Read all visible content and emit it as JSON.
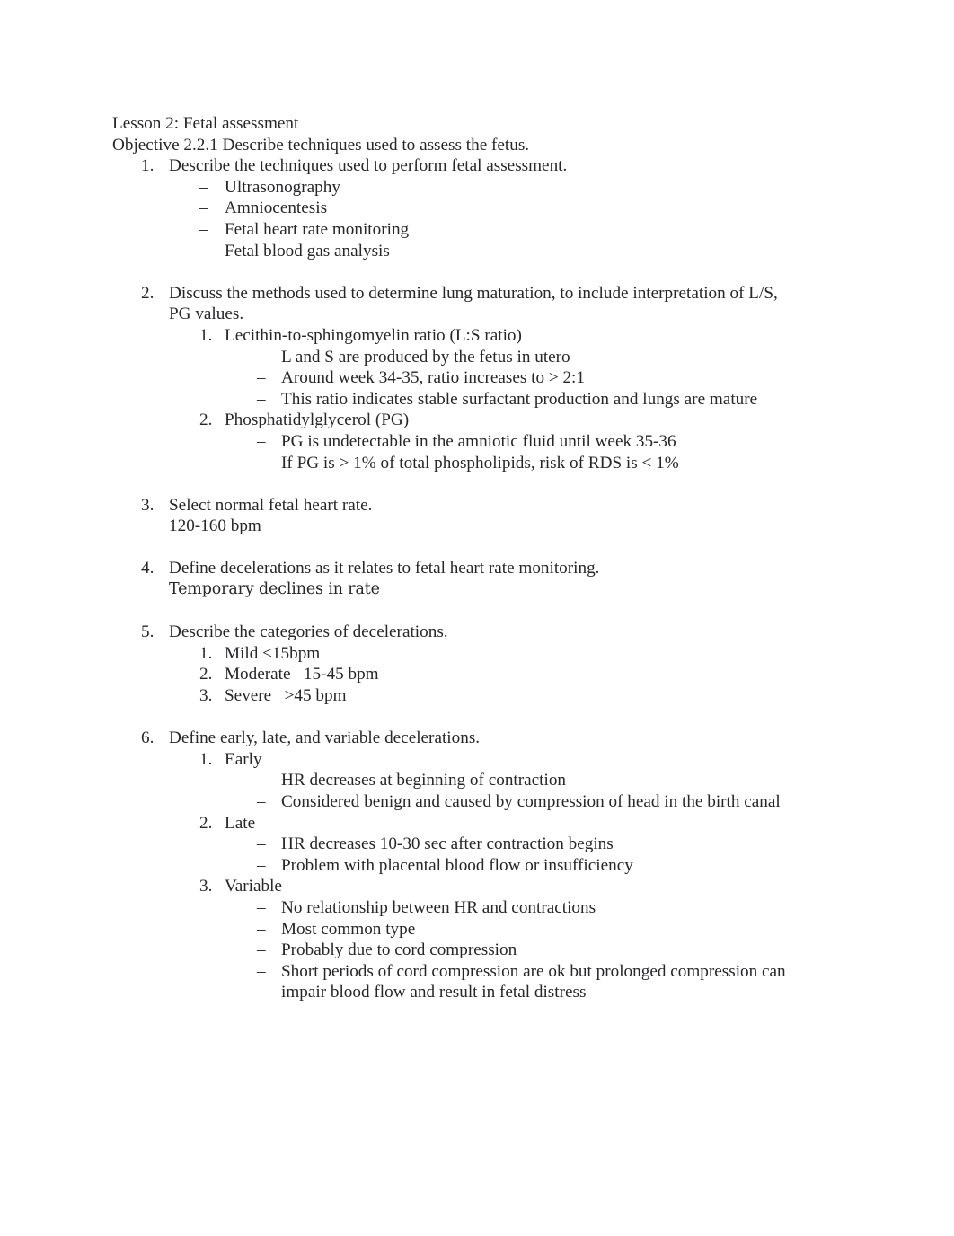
{
  "document": {
    "title_line": "Lesson 2: Fetal assessment",
    "objective_line": "Objective 2.2.1 Describe techniques used to assess the fetus.",
    "items": [
      {
        "marker": "1.",
        "text": "Describe the techniques used to perform fetal assessment.",
        "sub": [
          {
            "marker": "–",
            "text": "Ultrasonography"
          },
          {
            "marker": "–",
            "text": "Amniocentesis"
          },
          {
            "marker": "–",
            "text": "Fetal heart rate monitoring"
          },
          {
            "marker": "–",
            "text": "Fetal blood gas analysis"
          }
        ]
      },
      {
        "marker": "2.",
        "text": "Discuss the methods used to determine lung maturation, to include interpretation of L/S, PG values.",
        "sub": [
          {
            "marker": "1.",
            "text": "Lecithin-to-sphingomyelin ratio (L:S ratio)",
            "sub": [
              {
                "marker": "–",
                "text": "L and S are produced by the fetus in utero"
              },
              {
                "marker": "–",
                "text": "Around week 34-35, ratio increases to > 2:1"
              },
              {
                "marker": "–",
                "text": "This ratio indicates stable surfactant production and lungs are mature"
              }
            ]
          },
          {
            "marker": "2.",
            "text": "Phosphatidylglycerol (PG)",
            "sub": [
              {
                "marker": "–",
                "text": "PG is undetectable in the amniotic fluid until week 35-36"
              },
              {
                "marker": "–",
                "text": "If PG is > 1% of total phospholipids, risk of RDS is < 1%"
              }
            ]
          }
        ]
      },
      {
        "marker": "3.",
        "text": "Select normal fetal heart rate.",
        "answer": "120-160 bpm"
      },
      {
        "marker": "4.",
        "text": "Define decelerations as it relates to fetal heart rate monitoring.",
        "answer": "Temporary declines in rate"
      },
      {
        "marker": "5.",
        "text": "Describe the categories of decelerations.",
        "sub": [
          {
            "marker": "1.",
            "text": "Mild <15bpm"
          },
          {
            "marker": "2.",
            "text": "Moderate   15-45 bpm"
          },
          {
            "marker": "3.",
            "text": "Severe   >45 bpm"
          }
        ]
      },
      {
        "marker": "6.",
        "text": "Define early, late, and variable decelerations.",
        "sub": [
          {
            "marker": "1.",
            "text": "Early",
            "sub": [
              {
                "marker": "–",
                "text": "HR decreases at beginning of contraction"
              },
              {
                "marker": "–",
                "text": "Considered benign and caused by compression of head in the birth canal"
              }
            ]
          },
          {
            "marker": "2.",
            "text": "Late",
            "sub": [
              {
                "marker": "–",
                "text": "HR decreases 10-30 sec after contraction begins"
              },
              {
                "marker": "–",
                "text": "Problem with placental blood flow or insufficiency"
              }
            ]
          },
          {
            "marker": "3.",
            "text": "Variable",
            "sub": [
              {
                "marker": "–",
                "text": "No relationship between HR and contractions"
              },
              {
                "marker": "–",
                "text": "Most common type"
              },
              {
                "marker": "–",
                "text": "Probably due to cord compression"
              },
              {
                "marker": "–",
                "text": "Short periods of cord compression are ok but prolonged compression can impair blood flow and result in fetal distress"
              }
            ]
          }
        ]
      }
    ]
  }
}
